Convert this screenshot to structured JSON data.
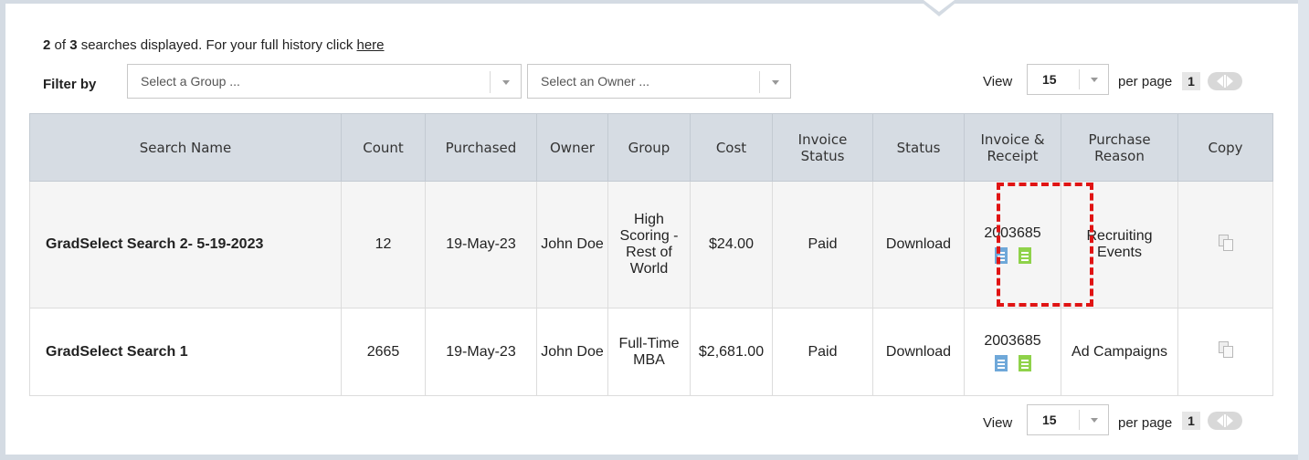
{
  "summary": {
    "shown": "2",
    "of_text": " of ",
    "total": "3",
    "rest_text": " searches displayed. For your full history click ",
    "link": "here"
  },
  "filter": {
    "label": "Filter by",
    "group_placeholder": "Select a Group ...",
    "owner_placeholder": "Select an Owner ..."
  },
  "pagination": {
    "view_label": "View",
    "page_size": "15",
    "per_page_label": "per page",
    "current_page": "1"
  },
  "table": {
    "headers": [
      "Search Name",
      "Count",
      "Purchased",
      "Owner",
      "Group",
      "Cost",
      "Invoice Status",
      "Status",
      "Invoice & Receipt",
      "Purchase Reason",
      "Copy"
    ],
    "rows": [
      {
        "search_name": "GradSelect Search 2- 5-19-2023",
        "count": "12",
        "purchased": "19-May-23",
        "owner": "John Doe",
        "group": "High Scoring - Rest of World",
        "cost": "$24.00",
        "invoice_status": "Paid",
        "status": "Download",
        "invoice_number": "2003685",
        "purchase_reason": "Recruiting Events"
      },
      {
        "search_name": "GradSelect Search 1",
        "count": "2665",
        "purchased": "19-May-23",
        "owner": "John Doe",
        "group": "Full-Time MBA",
        "cost": "$2,681.00",
        "invoice_status": "Paid",
        "status": "Download",
        "invoice_number": "2003685",
        "purchase_reason": "Ad Campaigns"
      }
    ]
  },
  "colors": {
    "header_bg": "#d6dce3",
    "link_blue": "#3a6a96",
    "highlight_red": "#e01414",
    "invoice_icon": "#6fa8d9",
    "receipt_icon": "#8fd24a"
  }
}
